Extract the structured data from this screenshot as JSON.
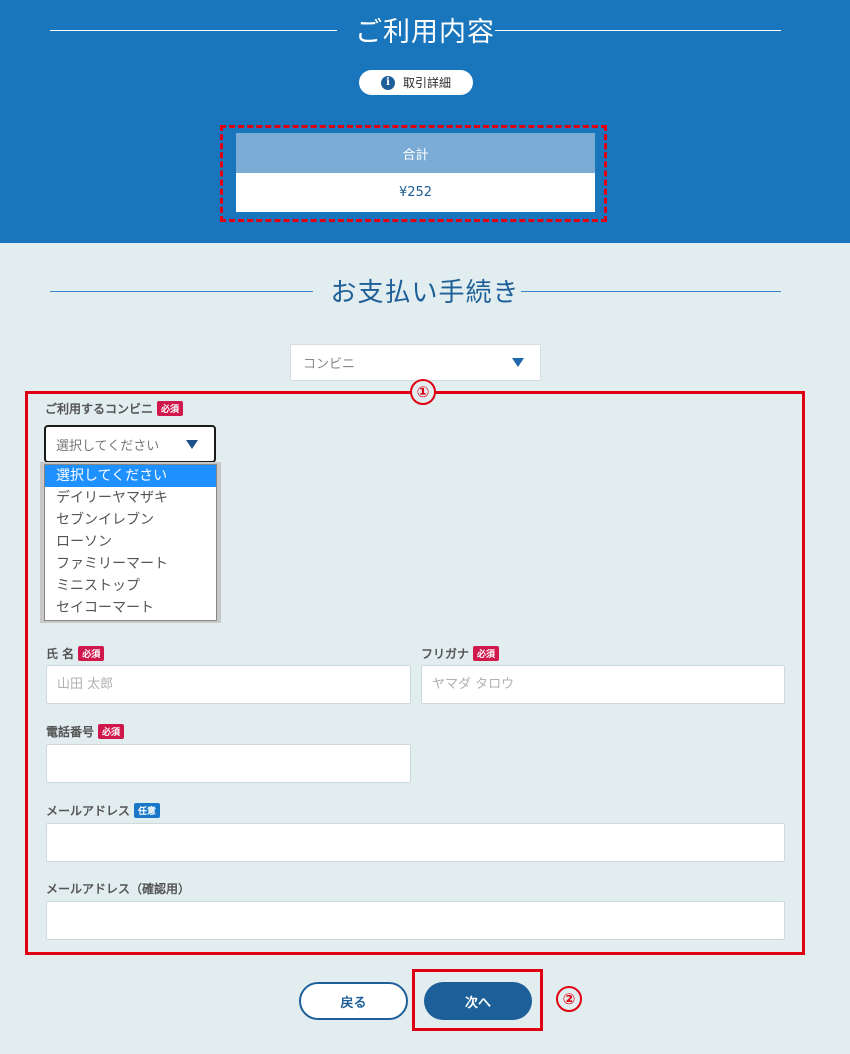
{
  "usage": {
    "title": "ご利用内容",
    "detail_button": "取引詳細",
    "info_icon_glyph": "i",
    "total_label": "合計",
    "total_value": "¥252"
  },
  "payment": {
    "title": "お支払い手続き",
    "method_selected": "コンビニ"
  },
  "annotations": {
    "marker1": "①",
    "marker2": "②",
    "highlight_color": "#e00012"
  },
  "form": {
    "store_label": "ご利用するコンビニ",
    "required_badge": "必須",
    "optional_badge": "任意",
    "store_selected": "選択してください",
    "store_options": [
      "選択してください",
      "デイリーヤマザキ",
      "セブンイレブン",
      "ローソン",
      "ファミリーマート",
      "ミニストップ",
      "セイコーマート"
    ],
    "name_label": "氏 名",
    "name_placeholder": "山田 太郎",
    "kana_label": "フリガナ",
    "kana_placeholder": "ヤマダ タロウ",
    "phone_label": "電話番号",
    "email_label": "メールアドレス",
    "email_confirm_label": "メールアドレス（確認用）"
  },
  "buttons": {
    "back": "戻る",
    "next": "次へ"
  },
  "colors": {
    "header_bg": "#1976bc",
    "page_bg": "#e2edf0",
    "button_blue": "#1d5f99",
    "dropdown_selected": "#1e90ff"
  }
}
